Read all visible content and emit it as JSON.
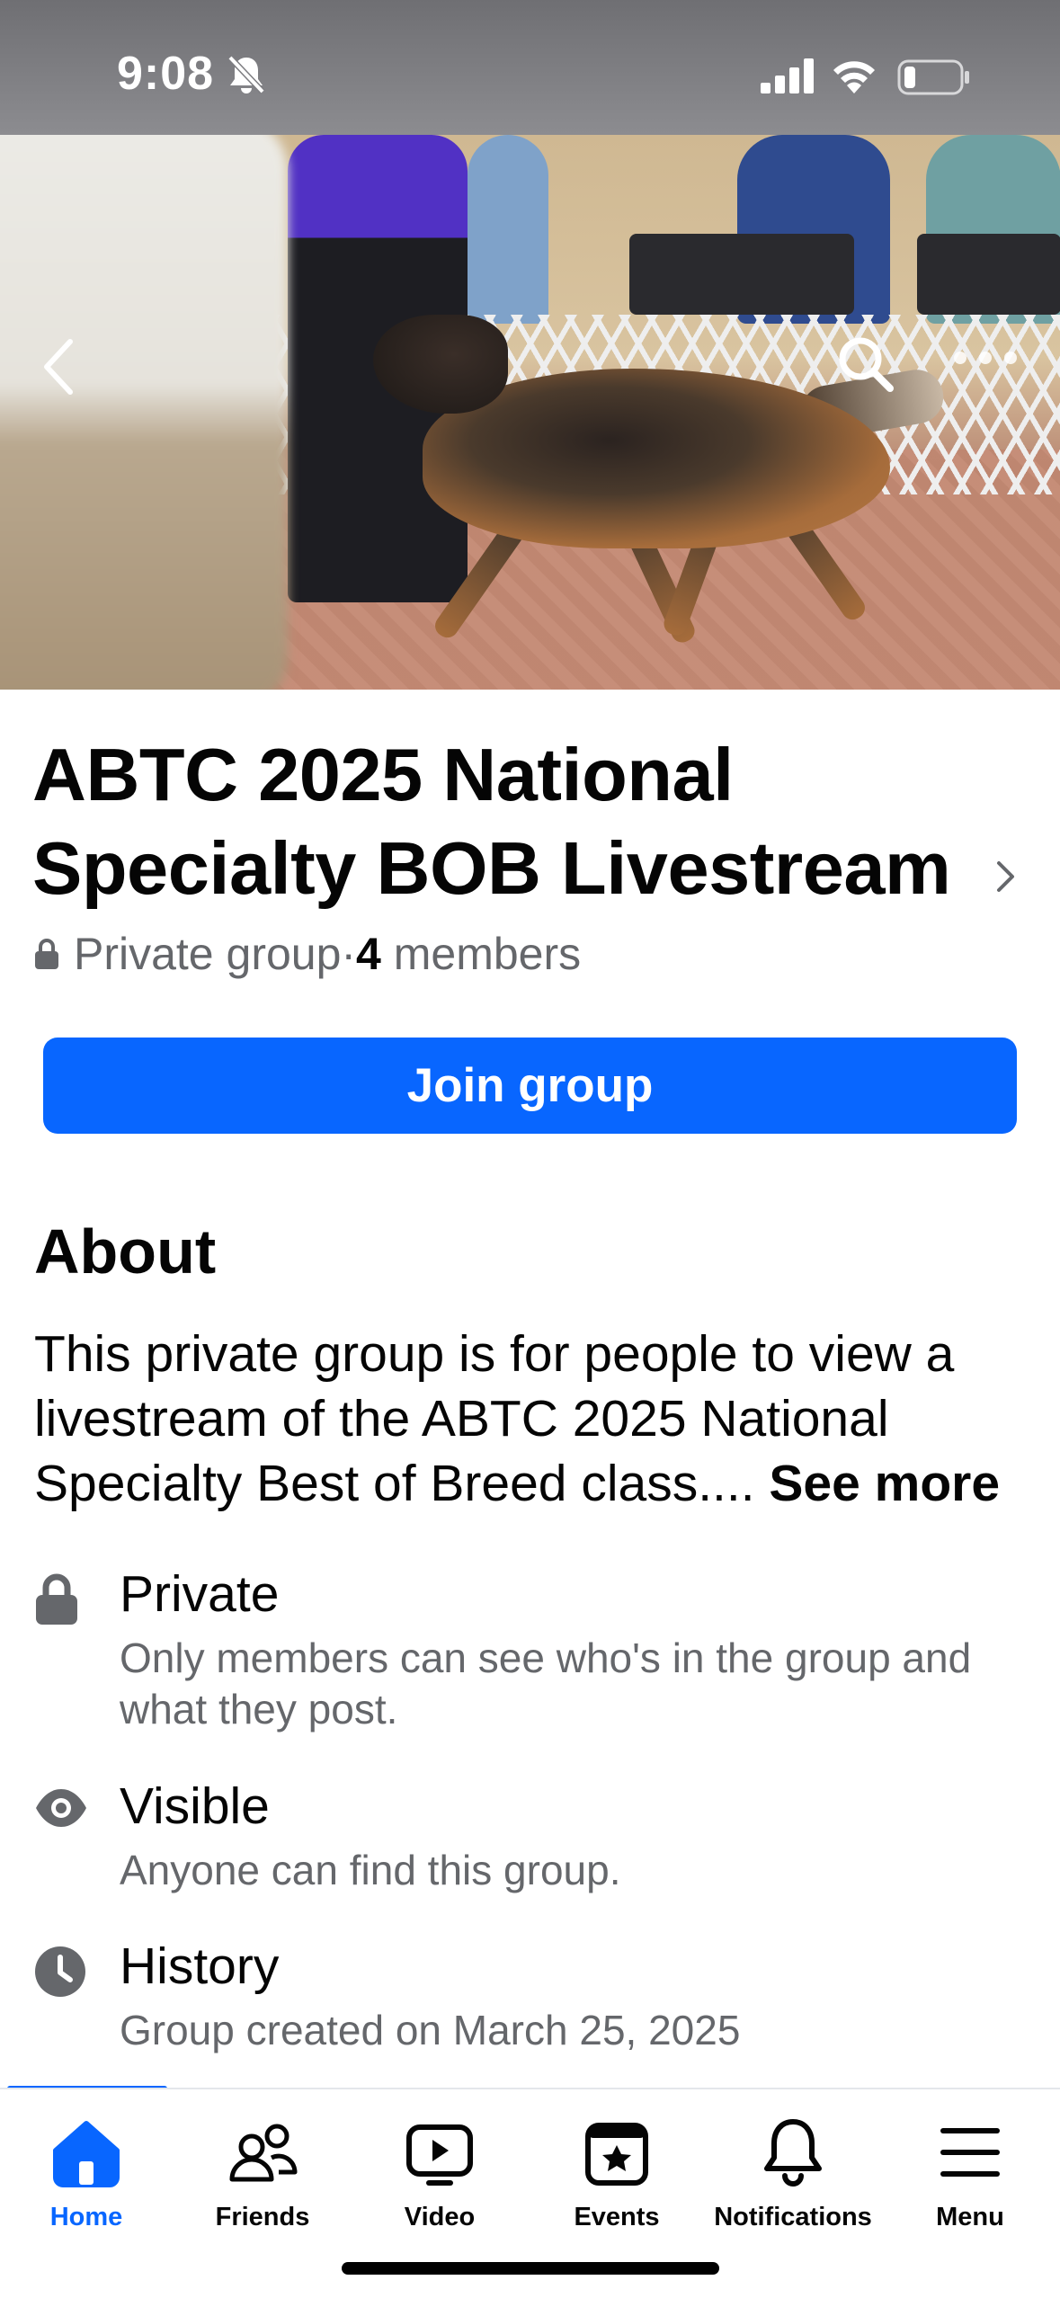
{
  "status_bar": {
    "time": "9:08"
  },
  "group": {
    "title": "ABTC 2025 National Specialty BOB Livestream",
    "privacy": "Private group",
    "separator": " · ",
    "member_count": "4",
    "member_label": " members",
    "join_label": "Join group"
  },
  "about": {
    "heading": "About",
    "description": "This private group is for people to view a livestream of the ABTC 2025 National Specialty Best of Breed class.... ",
    "see_more": "See more",
    "items": [
      {
        "icon": "lock-icon",
        "title": "Private",
        "description": "Only members can see who's in the group and what they post."
      },
      {
        "icon": "eye-icon",
        "title": "Visible",
        "description": "Anyone can find this group."
      },
      {
        "icon": "clock-icon",
        "title": "History",
        "description": "Group created on March 25, 2025"
      }
    ]
  },
  "nav": {
    "items": [
      {
        "label": "Home",
        "icon": "home-icon",
        "active": true
      },
      {
        "label": "Friends",
        "icon": "friends-icon",
        "active": false
      },
      {
        "label": "Video",
        "icon": "video-icon",
        "active": false
      },
      {
        "label": "Events",
        "icon": "events-icon",
        "active": false
      },
      {
        "label": "Notifications",
        "icon": "bell-icon",
        "active": false
      },
      {
        "label": "Menu",
        "icon": "menu-icon",
        "active": false
      }
    ]
  },
  "colors": {
    "accent": "#0866ff",
    "text_primary": "#050505",
    "text_secondary": "#65676b",
    "icon_gray": "#65676b"
  }
}
